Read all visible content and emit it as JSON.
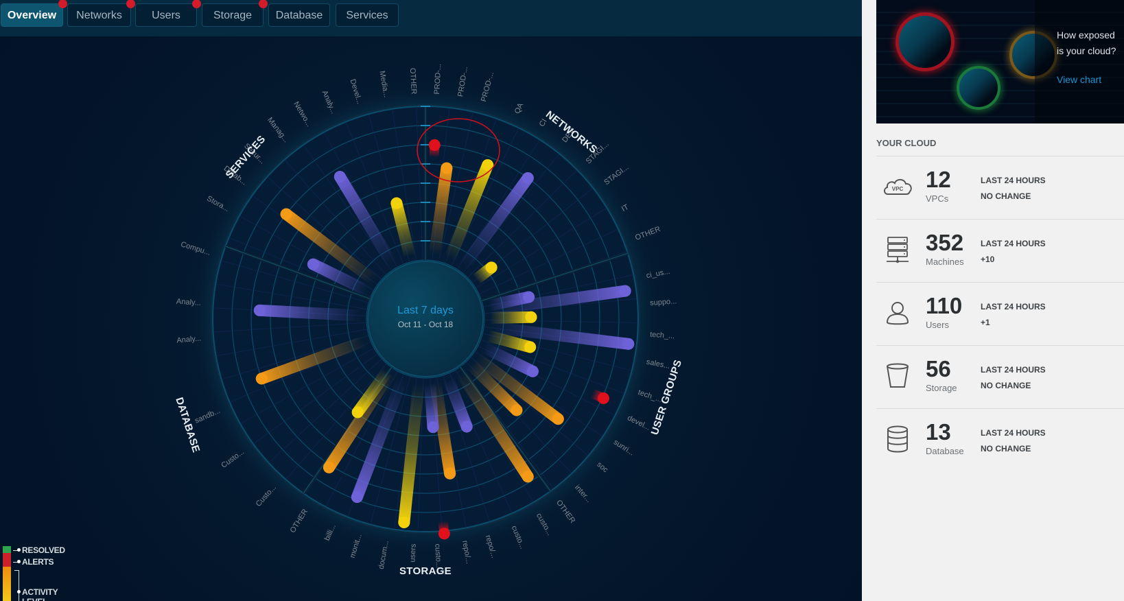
{
  "tabs": [
    {
      "label": "Overview",
      "active": true,
      "alert": true
    },
    {
      "label": "Networks",
      "active": false,
      "alert": true
    },
    {
      "label": "Users",
      "active": false,
      "alert": true
    },
    {
      "label": "Storage",
      "active": false,
      "alert": true
    },
    {
      "label": "Database",
      "active": false,
      "alert": false
    },
    {
      "label": "Services",
      "active": false,
      "alert": false
    }
  ],
  "colors": {
    "activity_orange": "#f49a16",
    "activity_yellow": "#f2d20c",
    "activity_purple": "#6e62d8",
    "alert": "#e0101c",
    "resolved": "#2ea44f",
    "accent": "#1e93d2"
  },
  "chart_data": {
    "type": "radial-bar",
    "title": "Last 7 days",
    "subtitle": "Oct 11 - Oct 18",
    "rings": 8,
    "sections": [
      {
        "name": "SERVICES",
        "labels": [
          "Analy...",
          "Compu...",
          "Stora...",
          "Datab...",
          "Secur...",
          "Manag...",
          "Netwo...",
          "Analy...",
          "Devel...",
          "Media...",
          "OTHER"
        ]
      },
      {
        "name": "NETWORKS",
        "labels": [
          "PROD-...",
          "PROD-...",
          "PROD-...",
          "QA",
          "CI",
          "DEV",
          "STAGI...",
          "STAGI...",
          "IT",
          "OTHER"
        ]
      },
      {
        "name": "USER GROUPS",
        "labels": [
          "ci_us...",
          "suppo...",
          "tech_...",
          "sales...",
          "tech_...",
          "devel...",
          "sunri...",
          "soc",
          "inter...",
          "OTHER"
        ]
      },
      {
        "name": "STORAGE",
        "labels": [
          "custo...",
          "custo...",
          "repo/...",
          "repo/...",
          "custo...",
          "users",
          "docum...",
          "monit...",
          "billi...",
          "OTHER"
        ]
      },
      {
        "name": "DATABASE",
        "labels": [
          "Custo...",
          "Custo...",
          "sandb...",
          "Analy..."
        ]
      }
    ],
    "bars": [
      {
        "angle_deg": -53,
        "type": "activity",
        "level": "orange",
        "value": 0.78
      },
      {
        "angle_deg": -31,
        "type": "activity",
        "level": "purple",
        "value": 0.72
      },
      {
        "angle_deg": -14,
        "type": "activity",
        "level": "yellow",
        "value": 0.38
      },
      {
        "angle_deg": -64,
        "type": "activity",
        "level": "purple",
        "value": 0.42
      },
      {
        "angle_deg": 8,
        "type": "activity",
        "level": "orange",
        "value": 0.62
      },
      {
        "angle_deg": 22,
        "type": "activity",
        "level": "yellow",
        "value": 0.72
      },
      {
        "angle_deg": 36,
        "type": "activity",
        "level": "purple",
        "value": 0.78
      },
      {
        "angle_deg": 52,
        "type": "activity",
        "level": "yellow",
        "value": 0.12
      },
      {
        "angle_deg": 3,
        "type": "alert",
        "value": 0.78
      },
      {
        "angle_deg": 78,
        "type": "activity",
        "level": "purple",
        "value": 0.28
      },
      {
        "angle_deg": 82,
        "type": "activity",
        "level": "purple",
        "value": 0.98
      },
      {
        "angle_deg": 89,
        "type": "activity",
        "level": "yellow",
        "value": 0.28
      },
      {
        "angle_deg": 97,
        "type": "activity",
        "level": "purple",
        "value": 1.0
      },
      {
        "angle_deg": 105,
        "type": "activity",
        "level": "yellow",
        "value": 0.3
      },
      {
        "angle_deg": 116,
        "type": "activity",
        "level": "purple",
        "value": 0.38
      },
      {
        "angle_deg": 114,
        "type": "alert",
        "value": 0.93
      },
      {
        "angle_deg": 127,
        "type": "activity",
        "level": "orange",
        "value": 0.72
      },
      {
        "angle_deg": 135,
        "type": "activity",
        "level": "orange",
        "value": 0.45
      },
      {
        "angle_deg": 147,
        "type": "activity",
        "level": "orange",
        "value": 0.88
      },
      {
        "angle_deg": 159,
        "type": "activity",
        "level": "purple",
        "value": 0.35
      },
      {
        "angle_deg": 171,
        "type": "activity",
        "level": "orange",
        "value": 0.65
      },
      {
        "angle_deg": 176,
        "type": "activity",
        "level": "purple",
        "value": 0.3
      },
      {
        "angle_deg": 175,
        "type": "alert",
        "value": 1.08
      },
      {
        "angle_deg": 186,
        "type": "activity",
        "level": "yellow",
        "value": 1.0
      },
      {
        "angle_deg": 201,
        "type": "activity",
        "level": "purple",
        "value": 0.9
      },
      {
        "angle_deg": 213,
        "type": "activity",
        "level": "orange",
        "value": 0.8
      },
      {
        "angle_deg": 216,
        "type": "activity",
        "level": "yellow",
        "value": 0.35
      },
      {
        "angle_deg": 250,
        "type": "activity",
        "level": "orange",
        "value": 0.78
      },
      {
        "angle_deg": 273,
        "type": "activity",
        "level": "purple",
        "value": 0.72
      }
    ],
    "highlight": {
      "type": "ellipse",
      "target": "alert in NETWORKS PROD-..."
    }
  },
  "legend": {
    "items": [
      {
        "label": "RESOLVED",
        "color": "#2ea44f"
      },
      {
        "label": "ALERTS",
        "color": "#d0202c"
      },
      {
        "label": "ACTIVITY LEVEL",
        "color": "#f0a010"
      }
    ]
  },
  "banner": {
    "question": "How exposed is your cloud?",
    "link": "View chart"
  },
  "sidebar": {
    "heading": "YOUR CLOUD",
    "stats": [
      {
        "icon": "vpc-cloud-icon",
        "icon_text": "VPC",
        "value": "12",
        "unit": "VPCs",
        "period": "LAST 24 HOURS",
        "change": "NO CHANGE"
      },
      {
        "icon": "server-rack-icon",
        "value": "352",
        "unit": "Machines",
        "period": "LAST 24 HOURS",
        "change": "+10"
      },
      {
        "icon": "user-icon",
        "value": "110",
        "unit": "Users",
        "period": "LAST 24 HOURS",
        "change": "+1"
      },
      {
        "icon": "bucket-icon",
        "value": "56",
        "unit": "Storage",
        "period": "LAST 24 HOURS",
        "change": "NO CHANGE"
      },
      {
        "icon": "database-icon",
        "value": "13",
        "unit": "Database",
        "period": "LAST 24 HOURS",
        "change": "NO CHANGE"
      }
    ]
  }
}
